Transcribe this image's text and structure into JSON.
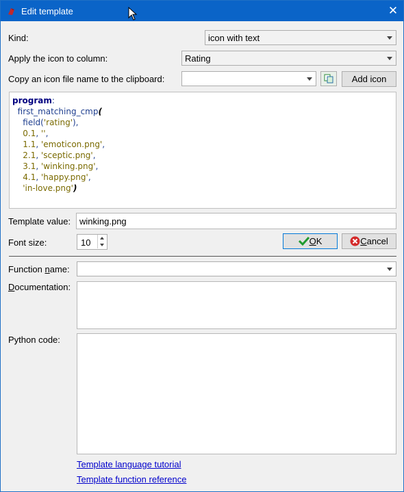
{
  "window": {
    "title": "Edit template",
    "close_glyph": "✕"
  },
  "kind": {
    "label": "Kind:",
    "value": "icon with text"
  },
  "apply_column": {
    "label": "Apply the icon to column:",
    "value": "Rating"
  },
  "copy_icon": {
    "label": "Copy an icon file name to the clipboard:",
    "value": "",
    "add_icon_label": "Add icon"
  },
  "code": [
    [
      {
        "t": "program",
        "c": "kw"
      },
      {
        "t": ":",
        "c": "fn"
      }
    ],
    [
      {
        "t": "  first_matching_cmp",
        "c": "fn"
      },
      {
        "t": "(",
        "c": "paren"
      }
    ],
    [
      {
        "t": "    field",
        "c": "fn"
      },
      {
        "t": "(",
        "c": "fn"
      },
      {
        "t": "'rating'",
        "c": "str"
      },
      {
        "t": "),",
        "c": "fn"
      }
    ],
    [
      {
        "t": "    0.1",
        "c": "num"
      },
      {
        "t": ", ",
        "c": "fn"
      },
      {
        "t": "''",
        "c": "str"
      },
      {
        "t": ",",
        "c": "fn"
      }
    ],
    [
      {
        "t": "    1.1",
        "c": "num"
      },
      {
        "t": ", ",
        "c": "fn"
      },
      {
        "t": "'emoticon.png'",
        "c": "str"
      },
      {
        "t": ",",
        "c": "fn"
      }
    ],
    [
      {
        "t": "    2.1",
        "c": "num"
      },
      {
        "t": ", ",
        "c": "fn"
      },
      {
        "t": "'sceptic.png'",
        "c": "str"
      },
      {
        "t": ",",
        "c": "fn"
      }
    ],
    [
      {
        "t": "    3.1",
        "c": "num"
      },
      {
        "t": ", ",
        "c": "fn"
      },
      {
        "t": "'winking.png'",
        "c": "str"
      },
      {
        "t": ",",
        "c": "fn"
      }
    ],
    [
      {
        "t": "    4.1",
        "c": "num"
      },
      {
        "t": ", ",
        "c": "fn"
      },
      {
        "t": "'happy.png'",
        "c": "str"
      },
      {
        "t": ",",
        "c": "fn"
      }
    ],
    [
      {
        "t": "    'in-love.png'",
        "c": "str"
      },
      {
        "t": ")",
        "c": "paren"
      }
    ]
  ],
  "template_value": {
    "label": "Template value:",
    "value": "winking.png"
  },
  "font_size": {
    "label": "Font size:",
    "value": "10"
  },
  "ok": {
    "label": "OK",
    "accel": "O",
    "rest": "K"
  },
  "cancel": {
    "label": "Cancel",
    "accel": "C",
    "rest": "ancel"
  },
  "function_name": {
    "label_pre": "Function ",
    "label_accel": "n",
    "label_post": "ame:",
    "value": ""
  },
  "documentation": {
    "label_accel": "D",
    "label_post": "ocumentation:"
  },
  "python_code": {
    "label": "Python code:"
  },
  "links": {
    "tutorial": "Template language tutorial",
    "reference": "Template function reference"
  },
  "colors": {
    "titlebar": "#0a64c8",
    "ok_border": "#0078d7",
    "link": "#0000cc"
  }
}
